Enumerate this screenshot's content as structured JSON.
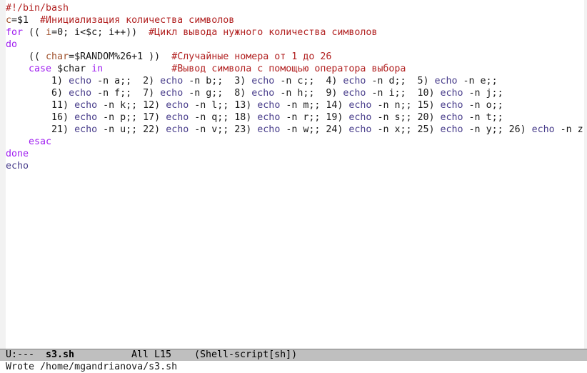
{
  "editor": {
    "lines": [
      [
        {
          "t": "#!/bin/bash",
          "k": "comment"
        }
      ],
      [
        {
          "t": "c",
          "k": "variable"
        },
        {
          "t": "=$1  ",
          "k": "plain"
        },
        {
          "t": "#Инициализация количества символов",
          "k": "comment"
        }
      ],
      [
        {
          "t": "for",
          "k": "keyword"
        },
        {
          "t": " (( ",
          "k": "plain"
        },
        {
          "t": "i",
          "k": "variable"
        },
        {
          "t": "=0; i<$c; i++))  ",
          "k": "plain"
        },
        {
          "t": "#Цикл вывода нужного количества символов",
          "k": "comment"
        }
      ],
      [
        {
          "t": "do",
          "k": "keyword"
        }
      ],
      [
        {
          "t": "    (( ",
          "k": "plain"
        },
        {
          "t": "char",
          "k": "variable"
        },
        {
          "t": "=$RANDOM%26+1 ))  ",
          "k": "plain"
        },
        {
          "t": "#Случайные номера от 1 до 26",
          "k": "comment"
        }
      ],
      [
        {
          "t": "    ",
          "k": "plain"
        },
        {
          "t": "case",
          "k": "keyword"
        },
        {
          "t": " $char ",
          "k": "plain"
        },
        {
          "t": "in",
          "k": "keyword"
        },
        {
          "t": "            ",
          "k": "plain"
        },
        {
          "t": "#Вывод символа с помощью оператора выбора",
          "k": "comment"
        }
      ],
      [
        {
          "t": "        1) ",
          "k": "plain"
        },
        {
          "t": "echo",
          "k": "builtin"
        },
        {
          "t": " -n a;;  2) ",
          "k": "plain"
        },
        {
          "t": "echo",
          "k": "builtin"
        },
        {
          "t": " -n b;;  3) ",
          "k": "plain"
        },
        {
          "t": "echo",
          "k": "builtin"
        },
        {
          "t": " -n c;;  4) ",
          "k": "plain"
        },
        {
          "t": "echo",
          "k": "builtin"
        },
        {
          "t": " -n d;;  5) ",
          "k": "plain"
        },
        {
          "t": "echo",
          "k": "builtin"
        },
        {
          "t": " -n e;;",
          "k": "plain"
        }
      ],
      [
        {
          "t": "        6) ",
          "k": "plain"
        },
        {
          "t": "echo",
          "k": "builtin"
        },
        {
          "t": " -n f;;  7) ",
          "k": "plain"
        },
        {
          "t": "echo",
          "k": "builtin"
        },
        {
          "t": " -n g;;  8) ",
          "k": "plain"
        },
        {
          "t": "echo",
          "k": "builtin"
        },
        {
          "t": " -n h;;  9) ",
          "k": "plain"
        },
        {
          "t": "echo",
          "k": "builtin"
        },
        {
          "t": " -n i;;  10) ",
          "k": "plain"
        },
        {
          "t": "echo",
          "k": "builtin"
        },
        {
          "t": " -n j;;",
          "k": "plain"
        }
      ],
      [
        {
          "t": "        11) ",
          "k": "plain"
        },
        {
          "t": "echo",
          "k": "builtin"
        },
        {
          "t": " -n k;; 12) ",
          "k": "plain"
        },
        {
          "t": "echo",
          "k": "builtin"
        },
        {
          "t": " -n l;; 13) ",
          "k": "plain"
        },
        {
          "t": "echo",
          "k": "builtin"
        },
        {
          "t": " -n m;; 14) ",
          "k": "plain"
        },
        {
          "t": "echo",
          "k": "builtin"
        },
        {
          "t": " -n n;; 15) ",
          "k": "plain"
        },
        {
          "t": "echo",
          "k": "builtin"
        },
        {
          "t": " -n o;;",
          "k": "plain"
        }
      ],
      [
        {
          "t": "        16) ",
          "k": "plain"
        },
        {
          "t": "echo",
          "k": "builtin"
        },
        {
          "t": " -n p;; 17) ",
          "k": "plain"
        },
        {
          "t": "echo",
          "k": "builtin"
        },
        {
          "t": " -n q;; 18) ",
          "k": "plain"
        },
        {
          "t": "echo",
          "k": "builtin"
        },
        {
          "t": " -n r;; 19) ",
          "k": "plain"
        },
        {
          "t": "echo",
          "k": "builtin"
        },
        {
          "t": " -n s;; 20) ",
          "k": "plain"
        },
        {
          "t": "echo",
          "k": "builtin"
        },
        {
          "t": " -n t;;",
          "k": "plain"
        }
      ],
      [
        {
          "t": "        21) ",
          "k": "plain"
        },
        {
          "t": "echo",
          "k": "builtin"
        },
        {
          "t": " -n u;; 22) ",
          "k": "plain"
        },
        {
          "t": "echo",
          "k": "builtin"
        },
        {
          "t": " -n v;; 23) ",
          "k": "plain"
        },
        {
          "t": "echo",
          "k": "builtin"
        },
        {
          "t": " -n w;; 24) ",
          "k": "plain"
        },
        {
          "t": "echo",
          "k": "builtin"
        },
        {
          "t": " -n x;; 25) ",
          "k": "plain"
        },
        {
          "t": "echo",
          "k": "builtin"
        },
        {
          "t": " -n y;; 26) ",
          "k": "plain"
        },
        {
          "t": "echo",
          "k": "builtin"
        },
        {
          "t": " -n z",
          "k": "plain"
        }
      ],
      [
        {
          "t": "    ",
          "k": "plain"
        },
        {
          "t": "esac",
          "k": "keyword"
        }
      ],
      [
        {
          "t": "done",
          "k": "keyword"
        }
      ],
      [
        {
          "t": "echo",
          "k": "builtin"
        }
      ]
    ]
  },
  "modeline": {
    "status": "U:---",
    "buffer_name": "s3.sh",
    "position": "All L15",
    "mode": "(Shell-script[sh])"
  },
  "echo_area": {
    "message": "Wrote /home/mgandrianova/s3.sh"
  },
  "colors": {
    "comment": "#b22222",
    "keyword": "#a020f0",
    "builtin": "#483d8b",
    "variable": "#a0522d",
    "modeline_bg": "#bfbfbf"
  }
}
